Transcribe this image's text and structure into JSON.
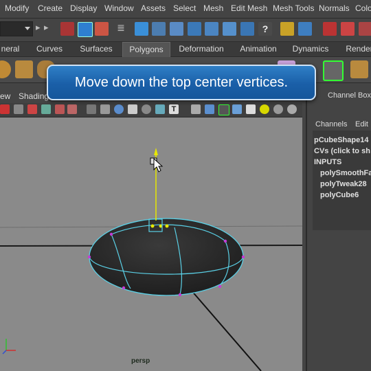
{
  "menubar": {
    "items": [
      "Modify",
      "Create",
      "Display",
      "Window",
      "Assets",
      "Select",
      "Mesh",
      "Edit Mesh",
      "Mesh Tools",
      "Normals",
      "Colo"
    ]
  },
  "statusline": {
    "icons": [
      "menu-set-selector",
      "snap-to-grid-icon",
      "select-by-hierarchy-icon",
      "select-by-object-type-icon",
      "select-by-component-type-icon",
      "filter-icon",
      "snap-to-curve-icon",
      "snap-to-point-icon",
      "snap-to-view-plane-icon",
      "make-live-icon",
      "history-icon",
      "lock-icon",
      "render-icon",
      "ipr-render-icon",
      "render-settings-icon",
      "magnet-icon",
      "question-icon"
    ]
  },
  "shelf": {
    "tabs": [
      "neral",
      "Curves",
      "Surfaces",
      "Polygons",
      "Deformation",
      "Animation",
      "Dynamics",
      "Render"
    ],
    "active_tab": "Polygons"
  },
  "panel": {
    "menu": [
      "ew",
      "Shading"
    ],
    "camera": "persp"
  },
  "channel_box": {
    "title": "Channel Box /",
    "menu": [
      "Channels",
      "Edit"
    ],
    "lines": [
      {
        "text": "pCubeShape14",
        "indent": false
      },
      {
        "text": "CVs (click to sh",
        "indent": false
      },
      {
        "text": "INPUTS",
        "indent": false
      },
      {
        "text": "polySmoothFa",
        "indent": true
      },
      {
        "text": "polyTweak28",
        "indent": true
      },
      {
        "text": "polyCube6",
        "indent": true
      }
    ]
  },
  "banner": {
    "text": "Move down the top center vertices."
  },
  "colors": {
    "accent_blue": "#1d63ad",
    "selection_cyan": "#5ad0e6",
    "manipulator_yellow": "#e8e800",
    "vertex_magenta": "#c43ad6"
  }
}
